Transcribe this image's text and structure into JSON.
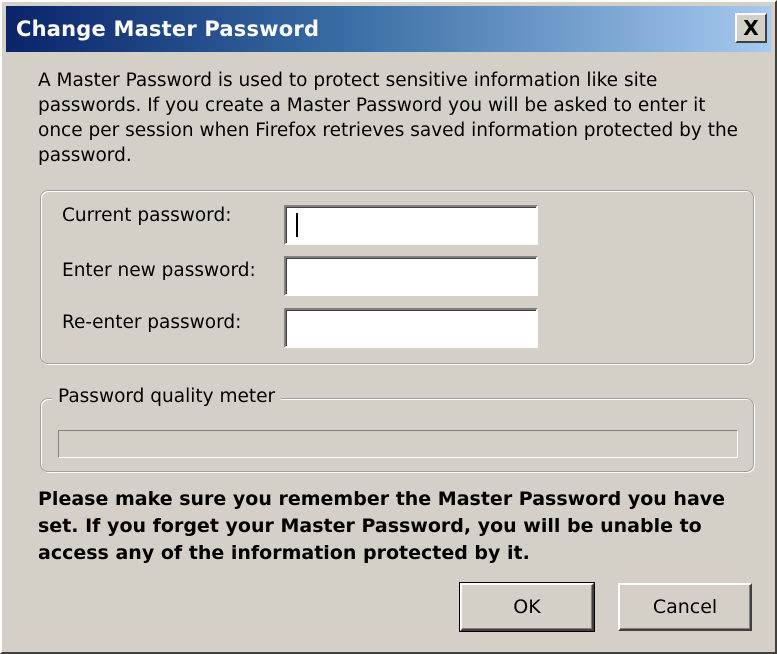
{
  "window": {
    "title": "Change Master Password",
    "close_label": "X"
  },
  "description": "A Master Password is used to protect sensitive information like site passwords. If you create a Master Password you will be asked to enter it once per session when Firefox retrieves saved information protected by the password.",
  "fields": {
    "current": {
      "label": "Current password:",
      "value": ""
    },
    "new": {
      "label": "Enter new password:",
      "value": ""
    },
    "reenter": {
      "label": "Re-enter password:",
      "value": ""
    }
  },
  "meter": {
    "label": "Password quality meter",
    "quality_percent": 0
  },
  "warning": "Please make sure you remember the Master Password you have set. If you forget your Master Password, you will be unable to access any of the information protected by it.",
  "buttons": {
    "ok": "OK",
    "cancel": "Cancel"
  }
}
